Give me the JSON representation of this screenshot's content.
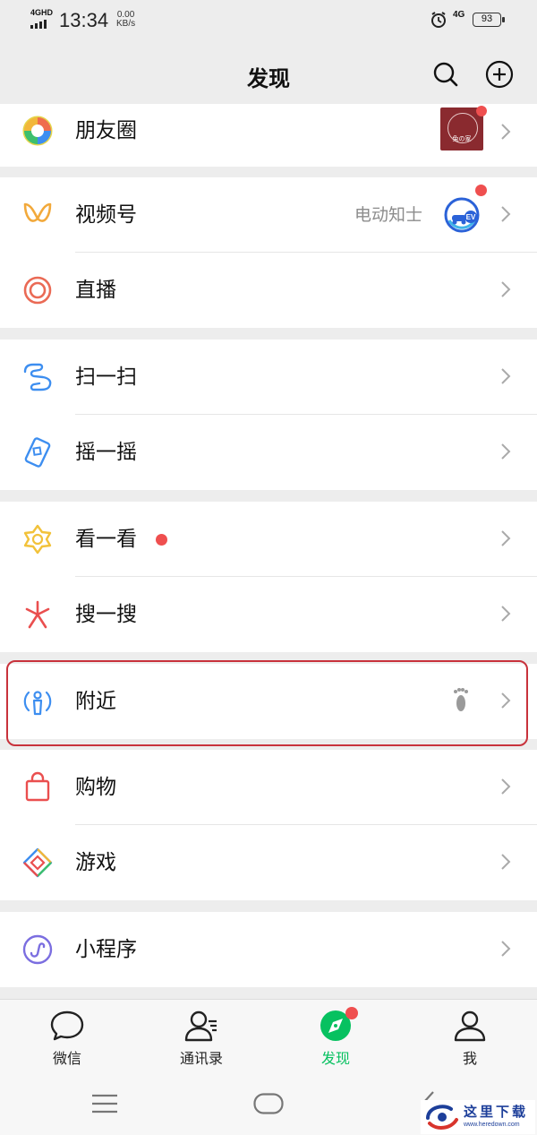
{
  "status_bar": {
    "network": "4GHD",
    "time": "13:34",
    "speed_value": "0.00",
    "speed_unit": "KB/s",
    "network_right": "4G",
    "battery": "93"
  },
  "header": {
    "title": "发现"
  },
  "groups": {
    "moments": {
      "label": "朋友圈"
    },
    "channels": {
      "label": "视频号",
      "subtitle": "电动知士"
    },
    "live": {
      "label": "直播"
    },
    "scan": {
      "label": "扫一扫"
    },
    "shake": {
      "label": "摇一摇"
    },
    "topstories": {
      "label": "看一看"
    },
    "search": {
      "label": "搜一搜"
    },
    "nearby": {
      "label": "附近"
    },
    "shopping": {
      "label": "购物"
    },
    "games": {
      "label": "游戏"
    },
    "miniprograms": {
      "label": "小程序"
    }
  },
  "tabbar": {
    "chats": "微信",
    "contacts": "通讯录",
    "discover": "发现",
    "me": "我"
  },
  "thumbnail": {
    "text": "兔の家"
  },
  "colors": {
    "accent": "#07c160",
    "badge": "#ef4f4f",
    "highlight": "#c8323c"
  },
  "watermark": {
    "text": "这里下载",
    "url": "www.heredown.com"
  }
}
